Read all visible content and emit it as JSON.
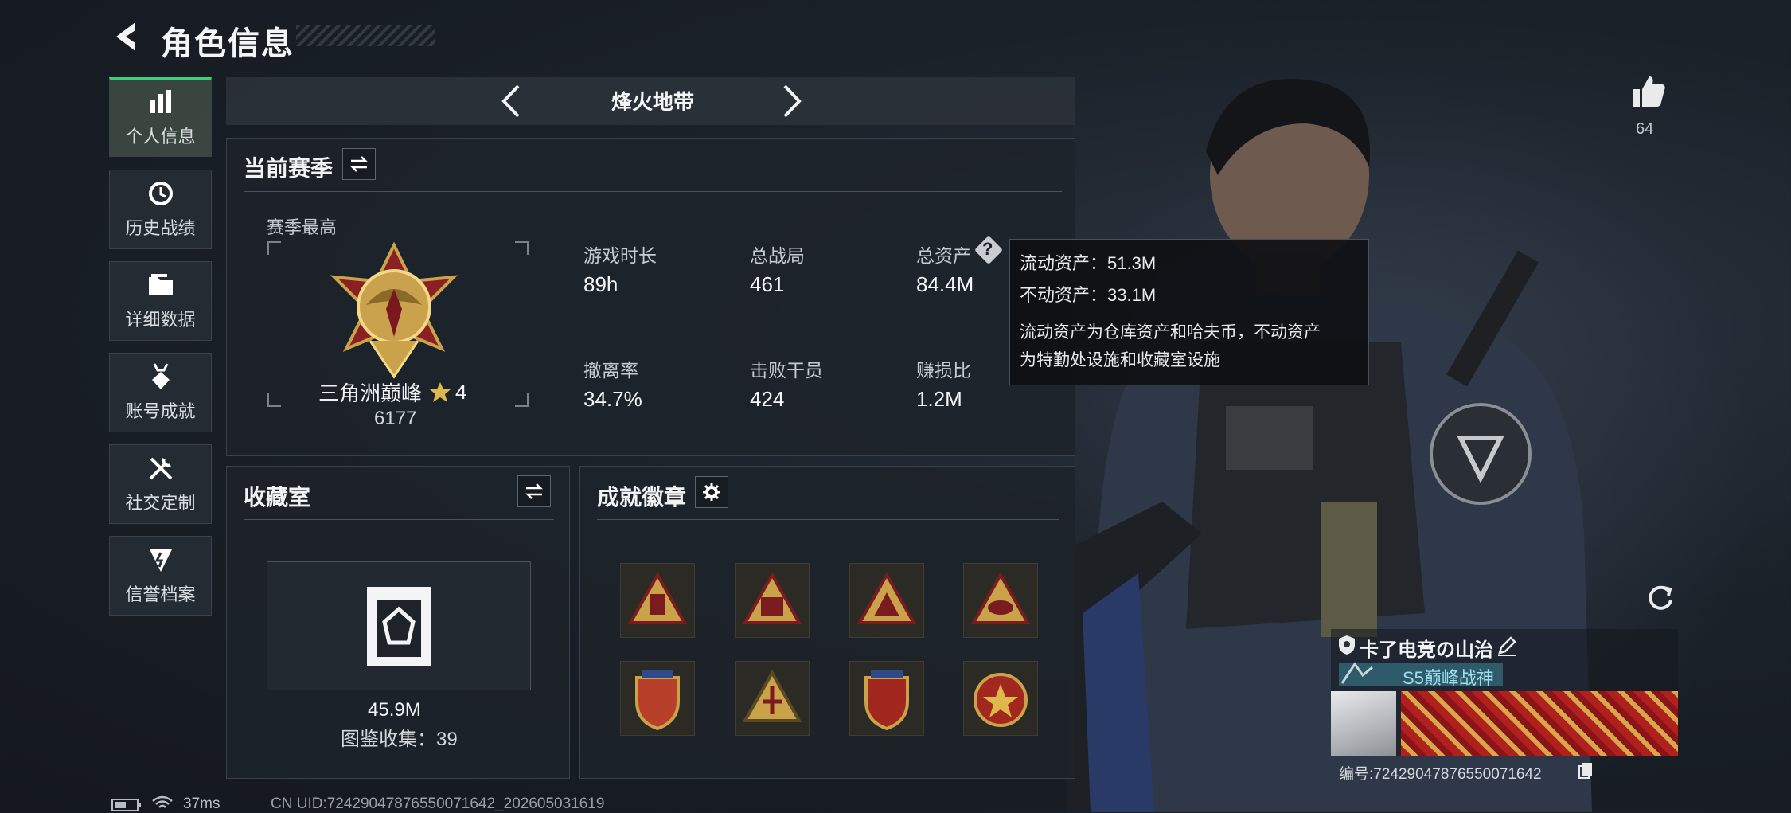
{
  "header": {
    "title": "角色信息"
  },
  "sidebar": {
    "items": [
      {
        "label": "个人信息"
      },
      {
        "label": "历史战绩"
      },
      {
        "label": "详细数据"
      },
      {
        "label": "账号成就"
      },
      {
        "label": "社交定制"
      },
      {
        "label": "信誉档案"
      }
    ]
  },
  "map": {
    "name": "烽火地带"
  },
  "season": {
    "title": "当前赛季",
    "best_label": "赛季最高",
    "rank_name": "三角洲巅峰",
    "rank_stars": "4",
    "rank_score": "6177",
    "stats": [
      {
        "label": "游戏时长",
        "value": "89h"
      },
      {
        "label": "总战局",
        "value": "461"
      },
      {
        "label": "总资产",
        "value": "84.4M"
      },
      {
        "label": "撤离率",
        "value": "34.7%"
      },
      {
        "label": "击败干员",
        "value": "424"
      },
      {
        "label": "赚损比",
        "value": "1.2M"
      }
    ]
  },
  "tooltip": {
    "liquid": "流动资产：51.3M",
    "fixed": "不动资产：33.1M",
    "desc1": "流动资产为仓库资产和哈夫币，不动资产",
    "desc2": "为特勤处设施和收藏室设施"
  },
  "collection": {
    "title": "收藏室",
    "value": "45.9M",
    "count": "图鉴收集：39"
  },
  "badges": {
    "title": "成就徽章"
  },
  "likes": {
    "count": "64"
  },
  "player": {
    "name": "卡了电竞の山治",
    "tag": "S5巅峰战神",
    "id": "编号:7242904787655007164​2"
  },
  "status": {
    "ping": "37ms",
    "uid": "CN UID:7242904787655007164​2_202605031619"
  },
  "colors": {
    "accent": "#3ad07b",
    "gold": "#c9a24a",
    "tag_bg": "#2f5a6a"
  }
}
